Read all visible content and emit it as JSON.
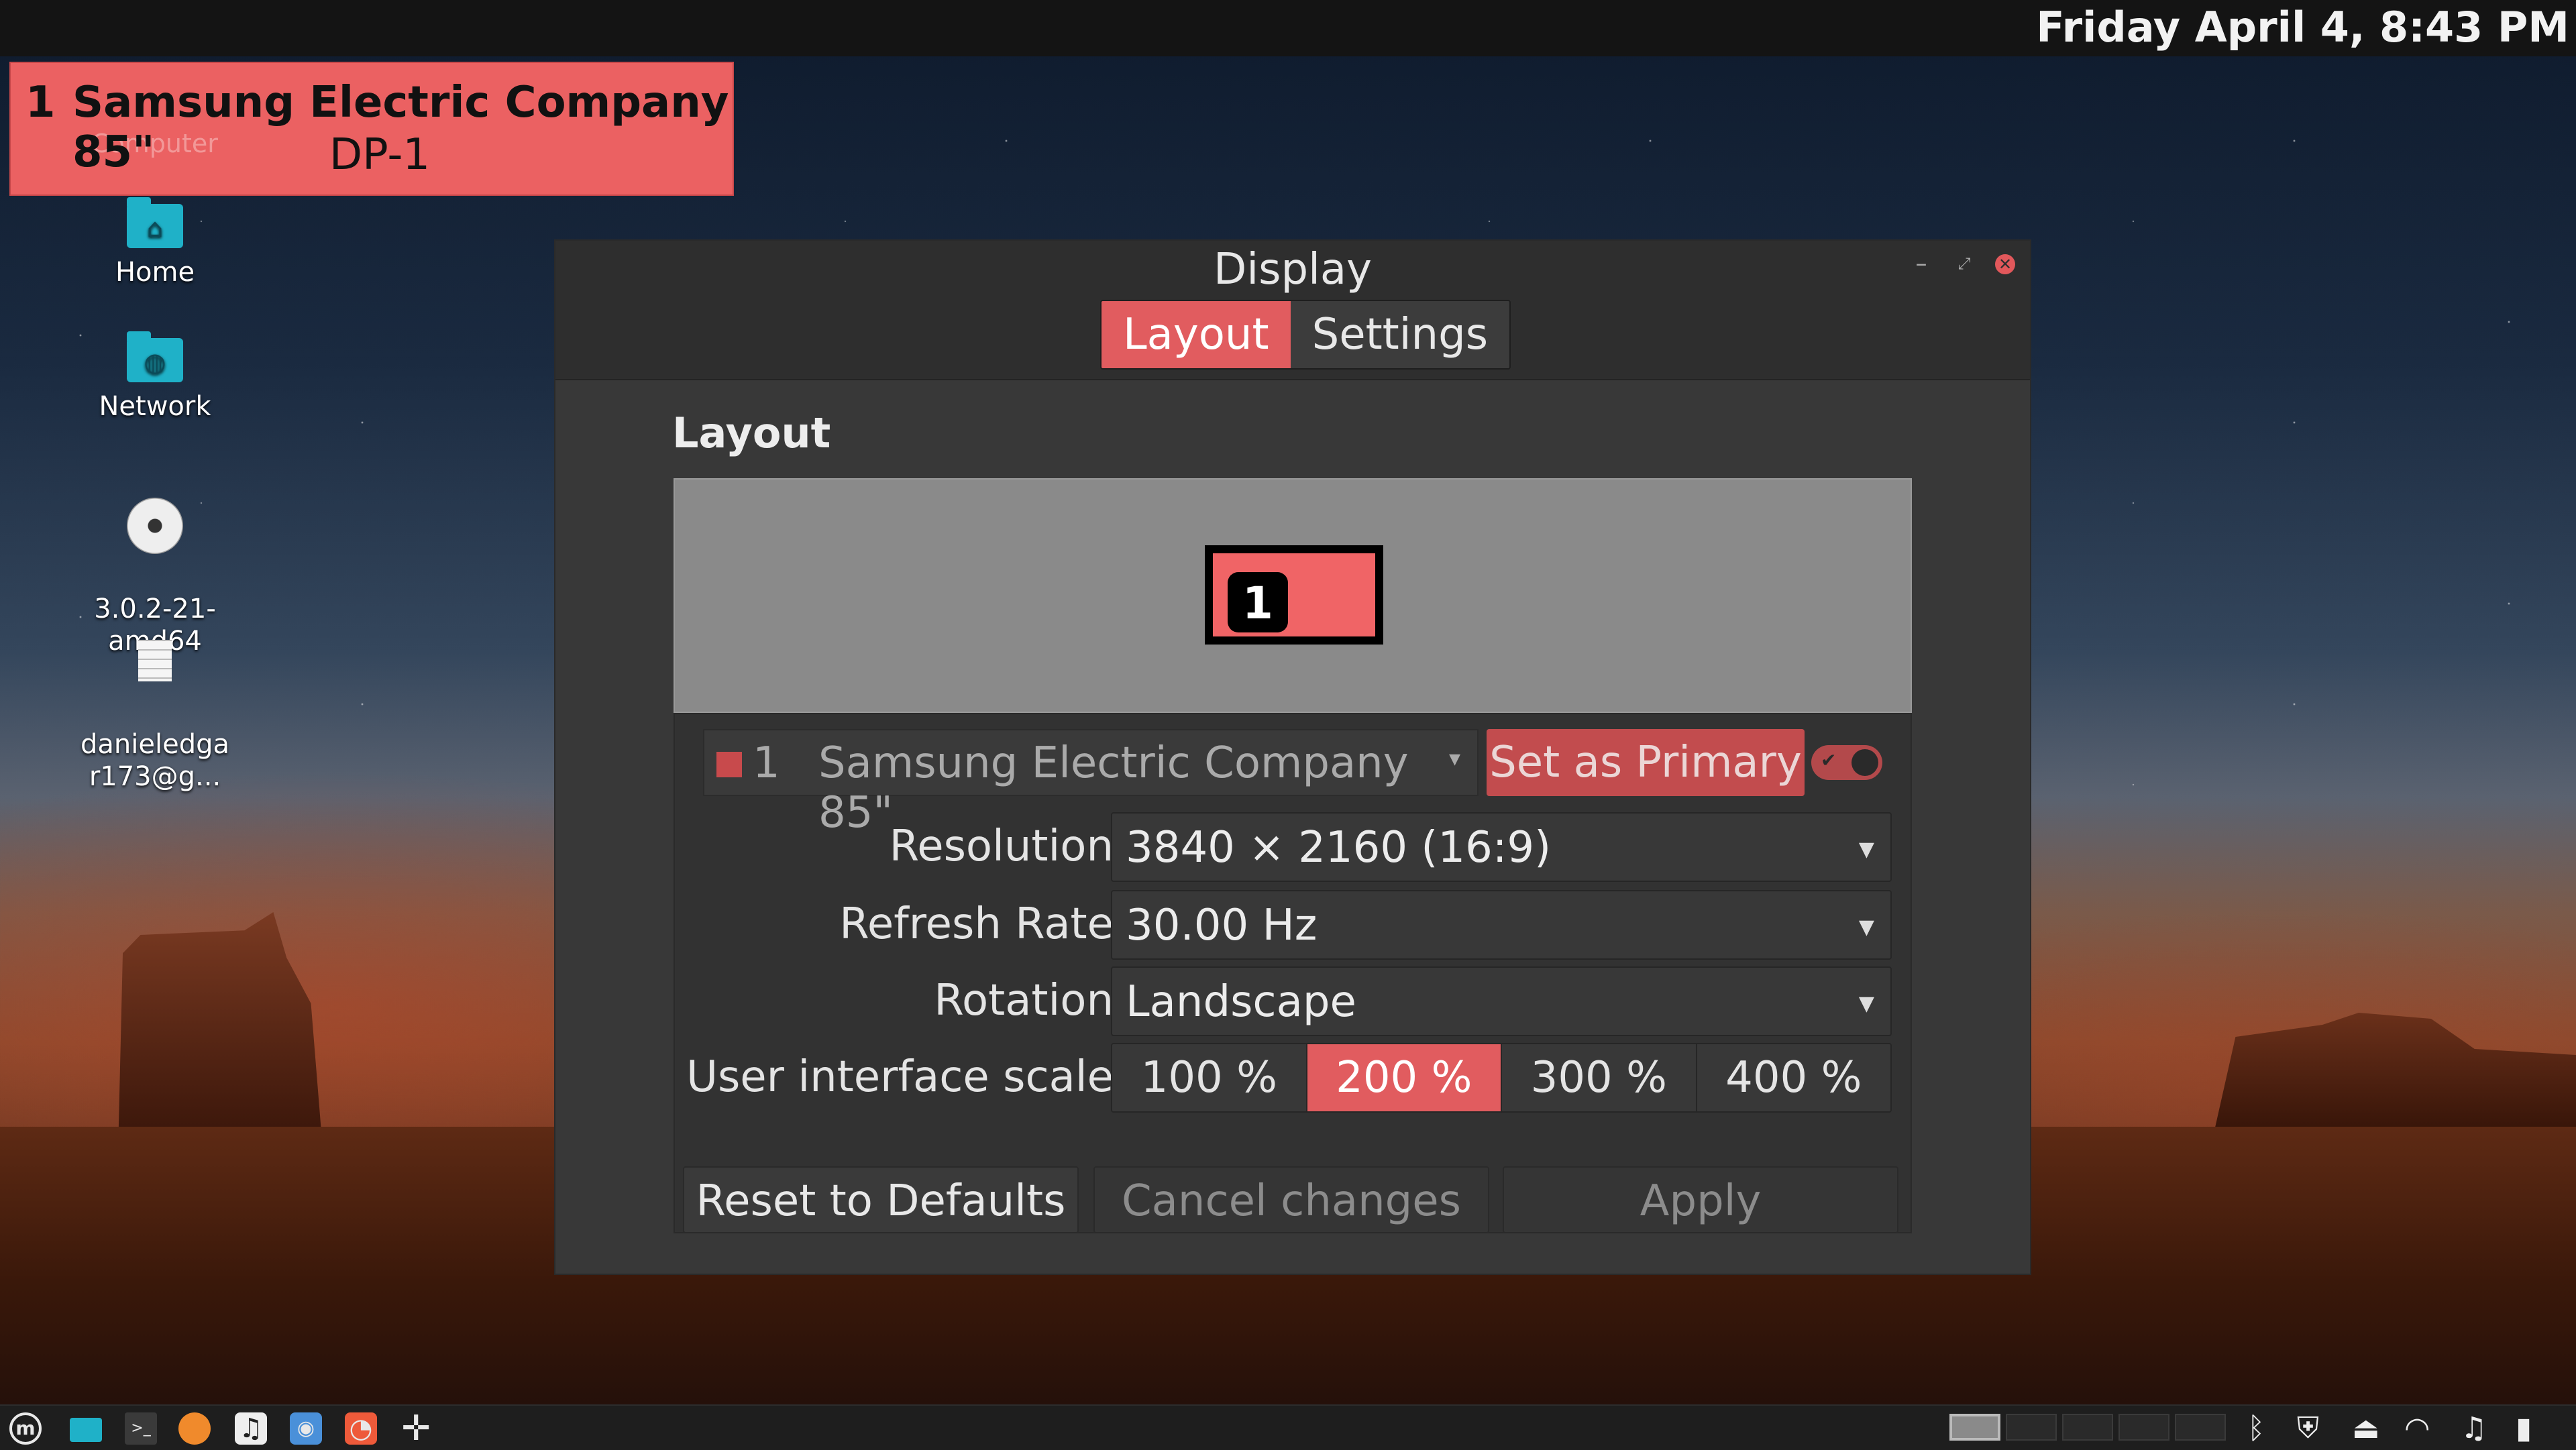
{
  "topbar": {
    "clock": "Friday April 4, 8:43 PM"
  },
  "identify_overlay": {
    "number": "1",
    "name": "Samsung Electric Company 85\"",
    "port": "DP-1",
    "under_label": "Computer",
    "color": "#eb6162"
  },
  "desktop_icons": [
    {
      "label": "Home",
      "icon": "home-folder-icon"
    },
    {
      "label": "Network",
      "icon": "network-folder-icon"
    },
    {
      "label": "3.0.2-21-\namd64",
      "icon": "disc-icon"
    },
    {
      "label": "danieledga\nr173@g...",
      "icon": "document-icon"
    }
  ],
  "window": {
    "title": "Display",
    "buttons": {
      "minimize": "–",
      "maximize": "⤢",
      "close": "✕"
    },
    "tabs": [
      {
        "label": "Layout",
        "active": true
      },
      {
        "label": "Settings",
        "active": false
      }
    ],
    "section_title": "Layout",
    "monitor_badge": "1",
    "monitor_selector": {
      "number": "1",
      "name": "Samsung Electric Company 85\"",
      "caret": "▾",
      "set_primary": "Set as Primary",
      "enabled": true
    },
    "fields": {
      "resolution": {
        "label": "Resolution",
        "value": "3840 × 2160 (16:9)"
      },
      "refresh_rate": {
        "label": "Refresh Rate",
        "value": "30.00 Hz"
      },
      "rotation": {
        "label": "Rotation",
        "value": "Landscape"
      },
      "ui_scale": {
        "label": "User interface scale",
        "options": [
          "100 %",
          "200 %",
          "300 %",
          "400 %"
        ],
        "selected": "200 %"
      }
    },
    "actions": {
      "reset": "Reset to Defaults",
      "cancel": "Cancel changes",
      "apply": "Apply"
    },
    "accent_color": "#e15c5f"
  },
  "taskbar": {
    "launchers": [
      "mint-menu-icon",
      "files-icon",
      "terminal-icon",
      "firefox-icon",
      "music-icon",
      "screenshot-icon",
      "software-manager-icon",
      "move-cross-icon"
    ],
    "workspaces": 5,
    "active_workspace": 1,
    "tray": [
      "bluetooth-icon",
      "shield-icon",
      "removable-drive-icon",
      "wifi-icon",
      "volume-music-icon",
      "battery-icon"
    ]
  }
}
